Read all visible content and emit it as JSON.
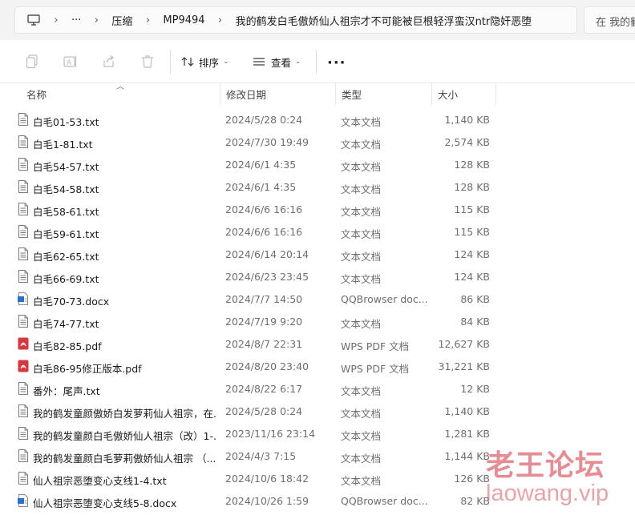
{
  "breadcrumb": {
    "more": "···",
    "items": [
      "压缩",
      "MP9494",
      "我的鹤发白毛傲娇仙人祖宗才不可能被巨根轻浮蛮汉ntr隐奸恶堕"
    ]
  },
  "search": {
    "placeholder": "在 我的鹤"
  },
  "toolbar": {
    "sort_label": "排序",
    "view_label": "查看",
    "more_label": "···"
  },
  "columns": {
    "name": "名称",
    "date": "修改日期",
    "type": "类型",
    "size": "大小"
  },
  "files": [
    {
      "icon": "txt-file-icon",
      "name": "白毛01-53.txt",
      "date": "2024/5/28 0:24",
      "type": "文本文档",
      "size": "1,140 KB"
    },
    {
      "icon": "txt-file-icon",
      "name": "白毛1-81.txt",
      "date": "2024/7/30 19:49",
      "type": "文本文档",
      "size": "2,574 KB"
    },
    {
      "icon": "txt-file-icon",
      "name": "白毛54-57.txt",
      "date": "2024/6/1 4:35",
      "type": "文本文档",
      "size": "128 KB"
    },
    {
      "icon": "txt-file-icon",
      "name": "白毛54-58.txt",
      "date": "2024/6/1 4:35",
      "type": "文本文档",
      "size": "128 KB"
    },
    {
      "icon": "txt-file-icon",
      "name": "白毛58-61.txt",
      "date": "2024/6/6 16:16",
      "type": "文本文档",
      "size": "115 KB"
    },
    {
      "icon": "txt-file-icon",
      "name": "白毛59-61.txt",
      "date": "2024/6/6 16:16",
      "type": "文本文档",
      "size": "115 KB"
    },
    {
      "icon": "txt-file-icon",
      "name": "白毛62-65.txt",
      "date": "2024/6/14 20:14",
      "type": "文本文档",
      "size": "124 KB"
    },
    {
      "icon": "txt-file-icon",
      "name": "白毛66-69.txt",
      "date": "2024/6/23 23:45",
      "type": "文本文档",
      "size": "124 KB"
    },
    {
      "icon": "docx-file-icon",
      "name": "白毛70-73.docx",
      "date": "2024/7/7 14:50",
      "type": "QQBrowser doc...",
      "size": "86 KB"
    },
    {
      "icon": "txt-file-icon",
      "name": "白毛74-77.txt",
      "date": "2024/7/19 9:20",
      "type": "文本文档",
      "size": "84 KB"
    },
    {
      "icon": "pdf-file-icon",
      "name": "白毛82-85.pdf",
      "date": "2024/8/7 22:31",
      "type": "WPS PDF 文档",
      "size": "12,627 KB"
    },
    {
      "icon": "pdf-file-icon",
      "name": "白毛86-95修正版本.pdf",
      "date": "2024/8/20 23:40",
      "type": "WPS PDF 文档",
      "size": "31,221 KB"
    },
    {
      "icon": "txt-file-icon",
      "name": "番外：尾声.txt",
      "date": "2024/8/22 6:17",
      "type": "文本文档",
      "size": "12 KB"
    },
    {
      "icon": "txt-file-icon",
      "name": "我的鹤发童颜傲娇白发萝莉仙人祖宗，在...",
      "date": "2024/5/28 0:24",
      "type": "文本文档",
      "size": "1,140 KB"
    },
    {
      "icon": "txt-file-icon",
      "name": "我的鹤发童颜白毛傲娇仙人祖宗（改）1-...",
      "date": "2023/11/16 23:14",
      "type": "文本文档",
      "size": "1,281 KB"
    },
    {
      "icon": "txt-file-icon",
      "name": "我的鹤发童颜白毛萝莉傲娇仙人祖宗 （...",
      "date": "2024/4/3 7:15",
      "type": "文本文档",
      "size": "1,144 KB"
    },
    {
      "icon": "txt-file-icon",
      "name": "仙人祖宗恶堕变心支线1-4.txt",
      "date": "2024/10/6 18:42",
      "type": "文本文档",
      "size": "126 KB"
    },
    {
      "icon": "docx-file-icon",
      "name": "仙人祖宗恶堕变心支线5-8.docx",
      "date": "2024/10/26 1:59",
      "type": "QQBrowser doc...",
      "size": "82 KB"
    }
  ],
  "watermark": {
    "line1": "老王论坛",
    "line2": "laowang.vip"
  },
  "colors": {
    "watermark": "#e06670",
    "pdf_red": "#d9363e",
    "docx_blue": "#2b6fd6",
    "txt_gray": "#7a7a7a"
  }
}
